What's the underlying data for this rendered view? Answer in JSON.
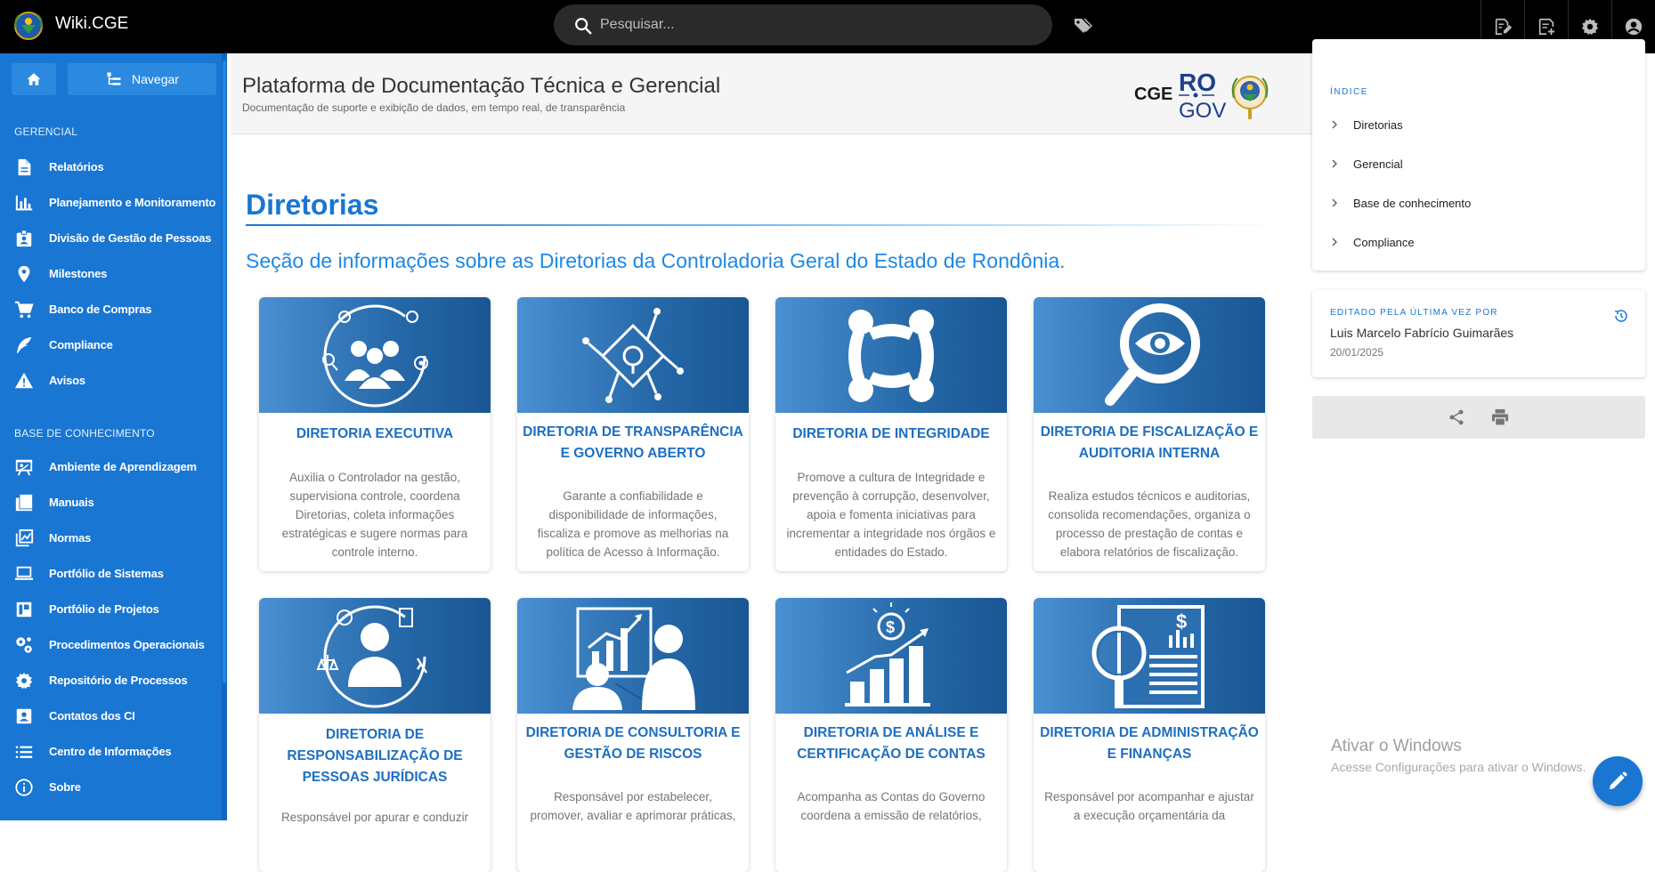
{
  "app": {
    "brand": "Wiki.CGE"
  },
  "search": {
    "placeholder": "Pesquisar..."
  },
  "top_actions": [
    {
      "icon": "edit-page-icon"
    },
    {
      "icon": "new-page-icon"
    },
    {
      "icon": "gear-icon"
    },
    {
      "icon": "account-icon"
    }
  ],
  "sidebar": {
    "nav_label": "Navegar",
    "sections": [
      {
        "title": "GERENCIAL",
        "items": [
          {
            "label": "Relatórios",
            "icon": "document-icon"
          },
          {
            "label": "Planejamento e Monitoramento",
            "icon": "bar-chart-icon"
          },
          {
            "label": "Divisão de Gestão de Pessoas",
            "icon": "badge-icon"
          },
          {
            "label": "Milestones",
            "icon": "map-pin-icon"
          },
          {
            "label": "Banco de Compras",
            "icon": "cart-icon"
          },
          {
            "label": "Compliance",
            "icon": "feather-icon"
          },
          {
            "label": "Avisos",
            "icon": "warning-icon"
          }
        ]
      },
      {
        "title": "BASE DE CONHECIMENTO",
        "items": [
          {
            "label": "Ambiente de Aprendizagem",
            "icon": "presentation-icon"
          },
          {
            "label": "Manuais",
            "icon": "books-icon"
          },
          {
            "label": "Normas",
            "icon": "chart-box-icon"
          },
          {
            "label": "Portfólio de Sistemas",
            "icon": "laptop-icon"
          },
          {
            "label": "Portfólio de Projetos",
            "icon": "board-icon"
          },
          {
            "label": "Procedimentos Operacionais",
            "icon": "cogs-icon"
          },
          {
            "label": "Repositório de Processos",
            "icon": "settings-icon"
          },
          {
            "label": "Contatos dos CI",
            "icon": "contact-icon"
          },
          {
            "label": "Centro de Informações",
            "icon": "list-icon"
          },
          {
            "label": "Sobre",
            "icon": "info-icon"
          }
        ]
      }
    ]
  },
  "header": {
    "title": "Plataforma de Documentação Técnica e Gerencial",
    "subtitle": "Documentação de suporte e exibição de dados, em tempo real, de transparência",
    "logo_text_cge": "CGE",
    "logo_text_ro": "RO",
    "logo_text_gov": "GOV"
  },
  "main": {
    "heading": "Diretorias",
    "lead": "Seção de informações sobre as Diretorias da Controladoria Geral do Estado de Rondônia.",
    "cards": [
      {
        "title": "DIRETORIA EXECUTIVA",
        "desc": "Auxilia o Controlador na gestão, supervisiona controle, coordena Diretorias, coleta informações estratégicas e sugere normas para controle interno.",
        "icon": "team-icon"
      },
      {
        "title": "DIRETORIA DE TRANSPARÊNCIA E GOVERNO ABERTO",
        "desc": "Garante a confiabilidade e disponibilidade de informações, fiscaliza e promove as melhorias na política de Acesso à Informação.",
        "icon": "network-icon"
      },
      {
        "title": "DIRETORIA DE INTEGRIDADE",
        "desc": "Promove a cultura de Integridade e prevenção à corrupção, desenvolver, apoia e fomenta iniciativas para incrementar a integridade nos órgãos e entidades do Estado.",
        "icon": "unity-icon"
      },
      {
        "title": "DIRETORIA DE FISCALIZAÇÃO E AUDITORIA INTERNA",
        "desc": "Realiza estudos técnicos e auditorias, consolida recomendações, organiza o processo de prestação de contas e elabora relatórios de fiscalização.",
        "icon": "magnifier-eye-icon"
      },
      {
        "title": "DIRETORIA DE RESPONSABILIZAÇÃO DE PESSOAS JURÍDICAS",
        "desc": "Responsável por apurar e conduzir",
        "icon": "person-justice-icon"
      },
      {
        "title": "DIRETORIA DE CONSULTORIA E GESTÃO DE RISCOS",
        "desc": "Responsável por estabelecer, promover, avaliar e aprimorar práticas,",
        "icon": "consulting-icon"
      },
      {
        "title": "DIRETORIA DE ANÁLISE E CERTIFICAÇÃO DE CONTAS",
        "desc": "Acompanha as Contas do Governo coordena a emissão de relatórios,",
        "icon": "growth-chart-icon"
      },
      {
        "title": "DIRETORIA DE ADMINISTRAÇÃO E FINANÇAS",
        "desc": "Responsável por acompanhar e ajustar a execução orçamentária da",
        "icon": "finance-report-icon"
      }
    ]
  },
  "toc": {
    "title": "ÍNDICE",
    "items": [
      "Diretorias",
      "Gerencial",
      "Base de conhecimento",
      "Compliance"
    ]
  },
  "edited": {
    "title": "EDITADO PELA ÚLTIMA VEZ POR",
    "name": "Luis Marcelo Fabrício Guimarães",
    "date": "20/01/2025"
  },
  "watermark": {
    "line1": "Ativar o Windows",
    "line2": "Acesse Configurações para ativar o Windows."
  },
  "colors": {
    "accent": "#1976d2",
    "sidebar": "#1976d2",
    "topbar": "#000000"
  }
}
